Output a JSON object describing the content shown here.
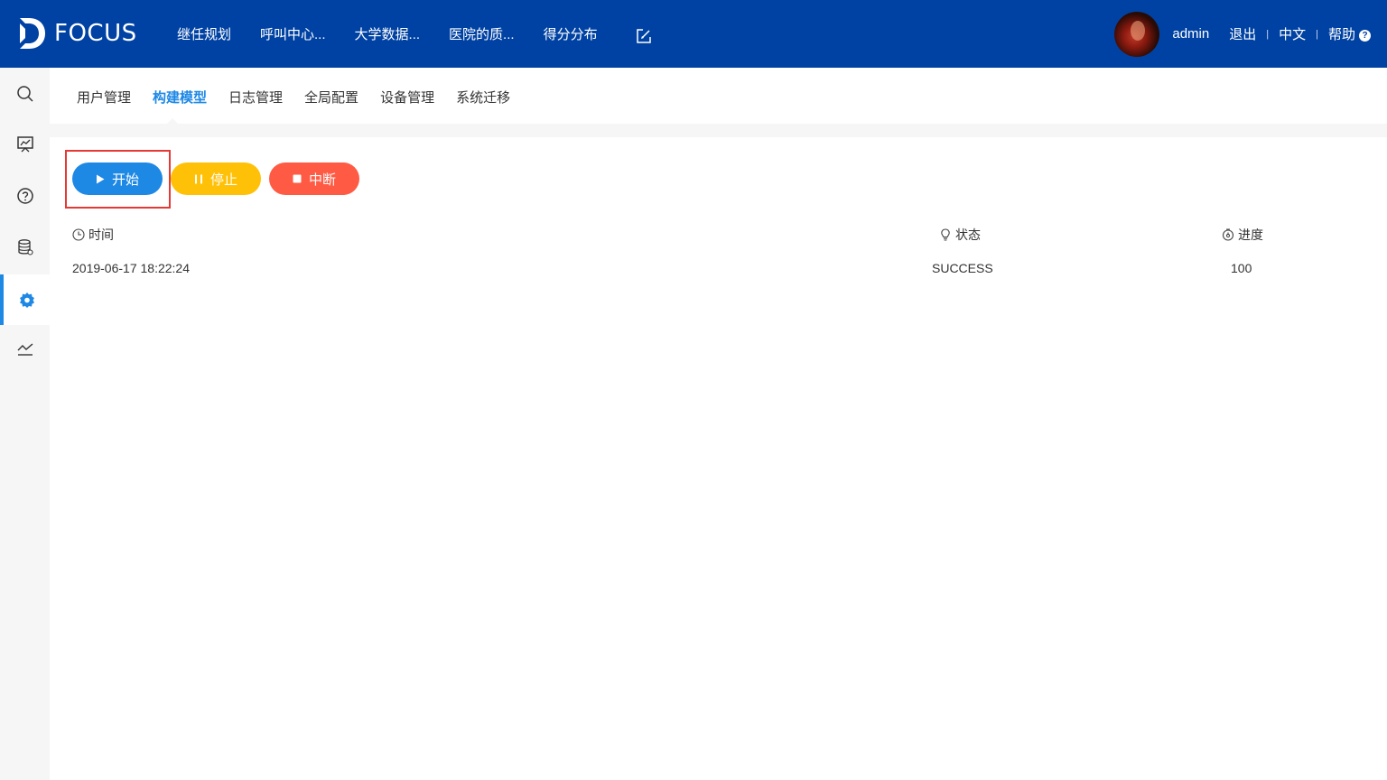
{
  "app": {
    "logo_text": "FOCUS"
  },
  "topnav": {
    "items": [
      "继任规划",
      "呼叫中心...",
      "大学数据...",
      "医院的质...",
      "得分分布"
    ]
  },
  "user": {
    "name": "admin",
    "logout": "退出",
    "lang": "中文",
    "help": "帮助",
    "help_mark": "?"
  },
  "subnav": {
    "items": [
      "用户管理",
      "构建模型",
      "日志管理",
      "全局配置",
      "设备管理",
      "系统迁移"
    ],
    "active_index": 1
  },
  "buttons": {
    "start": "开始",
    "stop": "停止",
    "abort": "中断"
  },
  "table": {
    "columns": [
      "时间",
      "状态",
      "进度"
    ],
    "rows": [
      {
        "time": "2019-06-17 18:22:24",
        "status": "SUCCESS",
        "progress": "100"
      }
    ]
  },
  "colors": {
    "topbar": "#0042a3",
    "accent": "#1e88e5",
    "stop": "#ffc107",
    "abort": "#ff5a44",
    "highlight": "#e53935"
  },
  "sidebar": {
    "icons": [
      "search-icon",
      "presentation-chart-icon",
      "help-circle-icon",
      "database-icon",
      "settings-gear-icon",
      "trend-line-icon"
    ],
    "active_index": 4
  }
}
